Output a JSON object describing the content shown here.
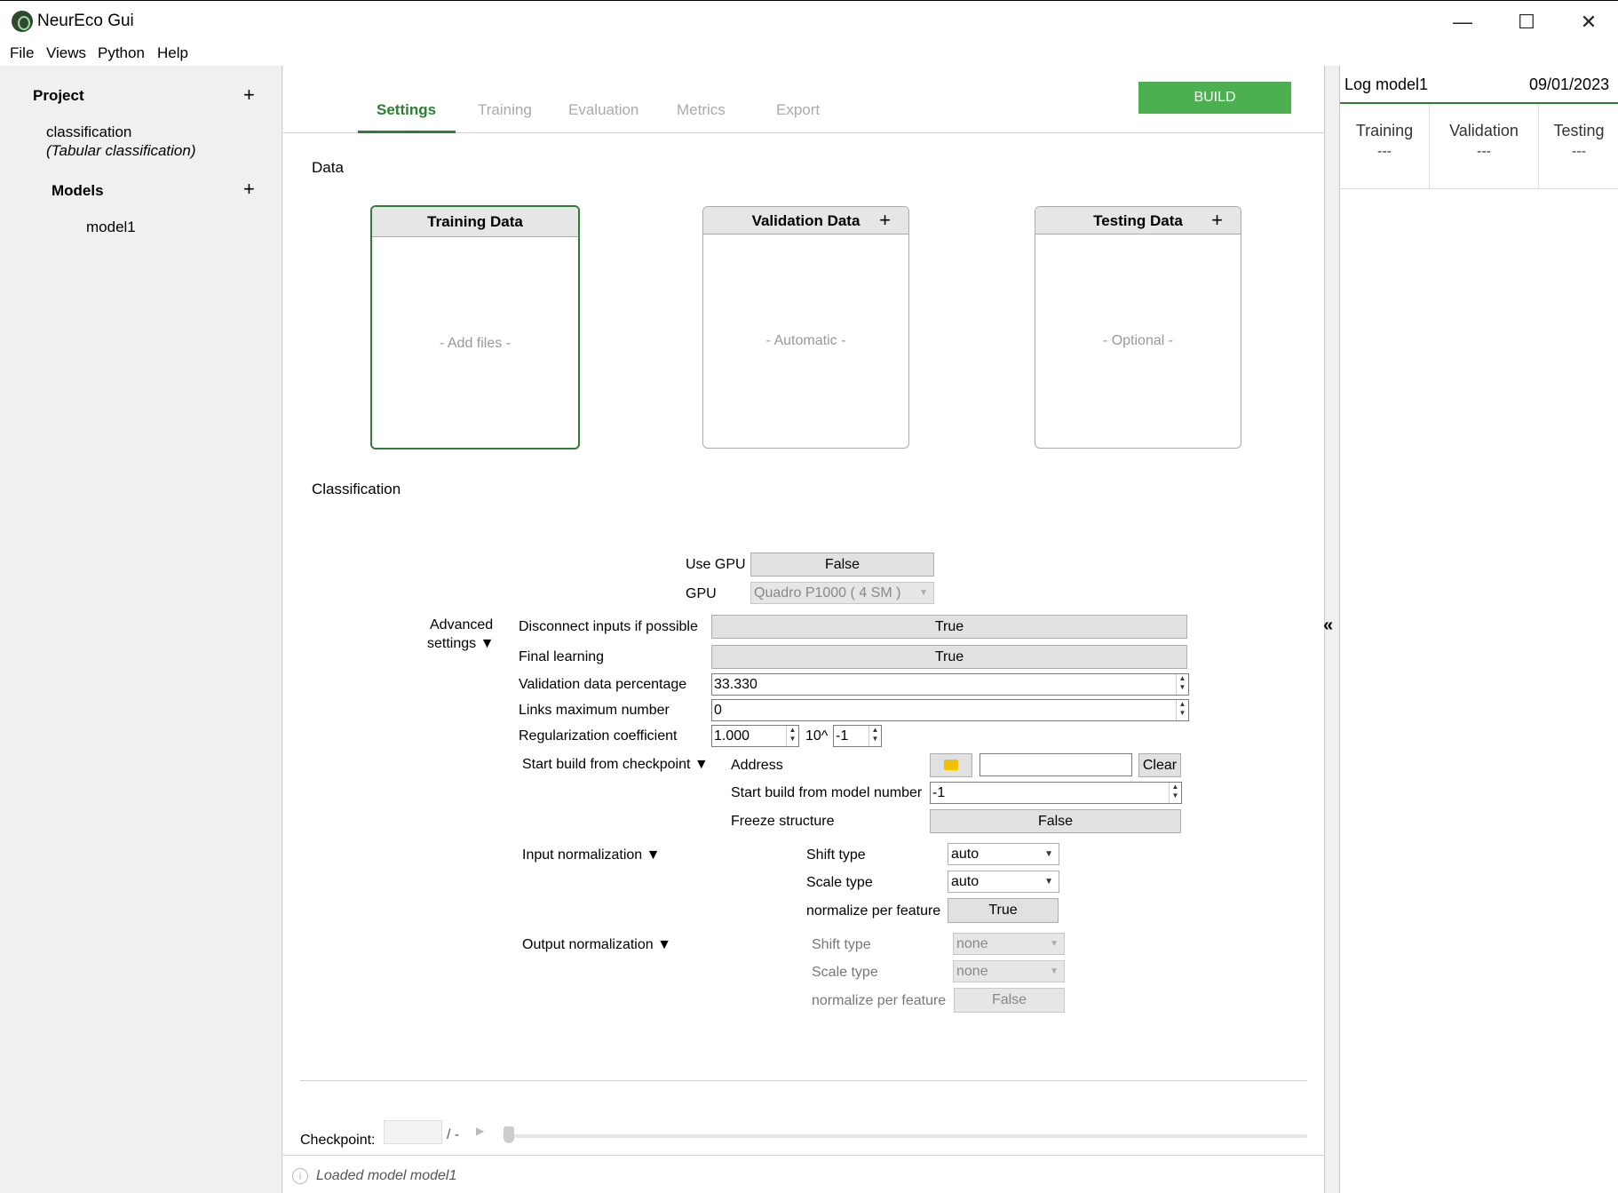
{
  "window": {
    "title": "NeurEco Gui",
    "minimize": "—",
    "maximize": "☐",
    "close": "✕"
  },
  "menu": [
    "File",
    "Views",
    "Python",
    "Help"
  ],
  "sidebar": {
    "project_label": "Project",
    "project_name": "classification",
    "project_type": "(Tabular classification)",
    "models_label": "Models",
    "models": [
      "model1"
    ],
    "add_symbol": "+"
  },
  "tabs": [
    "Settings",
    "Training",
    "Evaluation",
    "Metrics",
    "Export"
  ],
  "active_tab": "Settings",
  "build_label": "BUILD",
  "data_section": {
    "title": "Data",
    "boxes": [
      {
        "title": "Training Data",
        "placeholder": "- Add files -"
      },
      {
        "title": "Validation Data",
        "placeholder": "- Automatic -",
        "add": "+"
      },
      {
        "title": "Testing Data",
        "placeholder": "- Optional -",
        "add": "+"
      }
    ]
  },
  "classification": {
    "title": "Classification",
    "use_gpu_label": "Use GPU",
    "use_gpu_value": "False",
    "gpu_label": "GPU",
    "gpu_value": "Quadro P1000 ( 4 SM )",
    "advanced_label_1": "Advanced",
    "advanced_label_2": "settings ▼",
    "disconnect_label": "Disconnect inputs if possible",
    "disconnect_value": "True",
    "final_learning_label": "Final learning",
    "final_learning_value": "True",
    "val_pct_label": "Validation data percentage",
    "val_pct_value": "33.330",
    "links_max_label": "Links maximum number",
    "links_max_value": "0",
    "reg_coef_label": "Regularization coefficient",
    "reg_coef_value": "1.000",
    "reg_exp_label": "10^",
    "reg_exp_value": "-1",
    "checkpoint_label": "Start build from checkpoint ▼",
    "address_label": "Address",
    "clear_label": "Clear",
    "model_number_label": "Start build from model number",
    "model_number_value": "-1",
    "freeze_label": "Freeze structure",
    "freeze_value": "False",
    "input_norm_label": "Input normalization ▼",
    "input_shift_label": "Shift type",
    "input_shift_value": "auto",
    "input_scale_label": "Scale type",
    "input_scale_value": "auto",
    "input_per_feature_label": "normalize per feature",
    "input_per_feature_value": "True",
    "output_norm_label": "Output normalization ▼",
    "output_shift_label": "Shift type",
    "output_shift_value": "none",
    "output_scale_label": "Scale type",
    "output_scale_value": "none",
    "output_per_feature_label": "normalize per feature",
    "output_per_feature_value": "False"
  },
  "checkpoint_bar": {
    "label": "Checkpoint:",
    "value": "",
    "total": "/ -"
  },
  "status": {
    "message": "Loaded model model1"
  },
  "log": {
    "title": "Log model1",
    "date": "09/01/2023",
    "columns": [
      {
        "name": "Training",
        "value": "---"
      },
      {
        "name": "Validation",
        "value": "---"
      },
      {
        "name": "Testing",
        "value": "---"
      }
    ],
    "collapse_symbol": "«"
  }
}
